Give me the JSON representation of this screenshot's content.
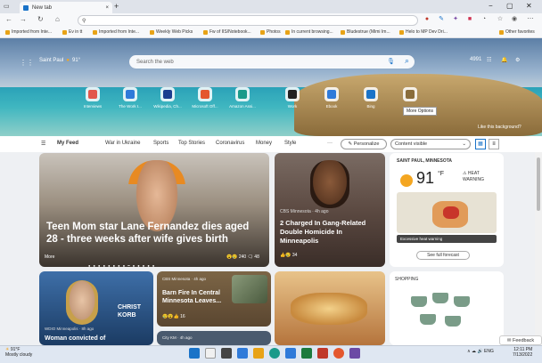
{
  "browser": {
    "tab_title": "New tab",
    "new_tab_symbol": "+",
    "close_symbol": "×",
    "window_controls": [
      "−",
      "▢",
      "✕"
    ],
    "nav": [
      "←",
      "→",
      "↻",
      "⌂"
    ],
    "url_search_symbol": "⚲",
    "favorites": [
      {
        "label": "Imported from Inte..."
      },
      {
        "label": "Ev in tt"
      },
      {
        "label": "Imported from Inte..."
      },
      {
        "label": "Weekly Web Picks"
      },
      {
        "label": "Fw of IIS/Notebook..."
      },
      {
        "label": "Photos"
      },
      {
        "label": "In current browsing..."
      },
      {
        "label": "Bludestrue (Mimi Im..."
      },
      {
        "label": "Helo to MP Dev Dri..."
      },
      {
        "label": "Other favorites"
      }
    ]
  },
  "hero": {
    "weather_location": "Saint Paul",
    "weather_temp": "91°",
    "search_placeholder": "Search the web",
    "top_right": [
      "4991",
      "☷",
      "🔔",
      "⚙"
    ],
    "quick_links": [
      {
        "label": "Interviews",
        "color": "#e2574c"
      },
      {
        "label": "The Work I...",
        "color": "#2f7ad9"
      },
      {
        "label": "Wikipedia, Ch...",
        "color": "#1c3e8f"
      },
      {
        "label": "Microsoft Off...",
        "color": "#e4572e"
      },
      {
        "label": "Amazon Assi...",
        "color": "#1b9a8a"
      },
      {
        "label": "Work",
        "color": "#222222"
      },
      {
        "label": "Ebook",
        "color": "#2f7ad9"
      },
      {
        "label": "Bing",
        "color": "#1a73c8"
      },
      {
        "label": "More Options",
        "color": "#8a6d3b"
      }
    ],
    "tooltip": "More Options",
    "like_background": "Like this background?"
  },
  "feed_nav": {
    "tabs": [
      "My Feed",
      "War in Ukraine",
      "Sports",
      "Top Stories",
      "Coronavirus",
      "Money",
      "Style"
    ],
    "more": "···",
    "personalize": "Personalize",
    "content_visible": "Content visible"
  },
  "main_story": {
    "headline": "Teen Mom star Lane Fernandez dies aged 28 - three weeks after wife gives birth",
    "source": "More",
    "reactions": "😮😢 240   🗨 48"
  },
  "story2": {
    "source": "CBS Minnesota · 4h ago",
    "headline": "2 Charged In Gang-Related Double Homicide In Minneapolis",
    "reactions": "👍😢 34"
  },
  "weather": {
    "location": "SAINT PAUL, MINNESOTA",
    "temp": "91",
    "unit": "°F",
    "warning": "⚠ HEAT WARNING",
    "alert": "Excessive heat warning",
    "forecast_btn": "See full forecast"
  },
  "bottom": {
    "b1_source": "WDIO Minneapolis · 8h ago",
    "b1_headline": "Woman convicted of",
    "b1_chyron": "CHRIST KORB",
    "b2_source": "CBS Minnesota · 4h ago",
    "b2_headline": "Barn Fire In Central Minnesota Leaves...",
    "b2_reactions": "😢😮👍 16",
    "b3_source": "City KM · 4h ago",
    "b5_label": "SHOPPING",
    "feedback": "Feedback"
  },
  "taskbar": {
    "weather_temp": "91°F",
    "weather_desc": "Mostly cloudy",
    "time": "12:11 PM",
    "date": "7/13/2022",
    "tray": "∧ ☁ 🔊 ENG"
  }
}
